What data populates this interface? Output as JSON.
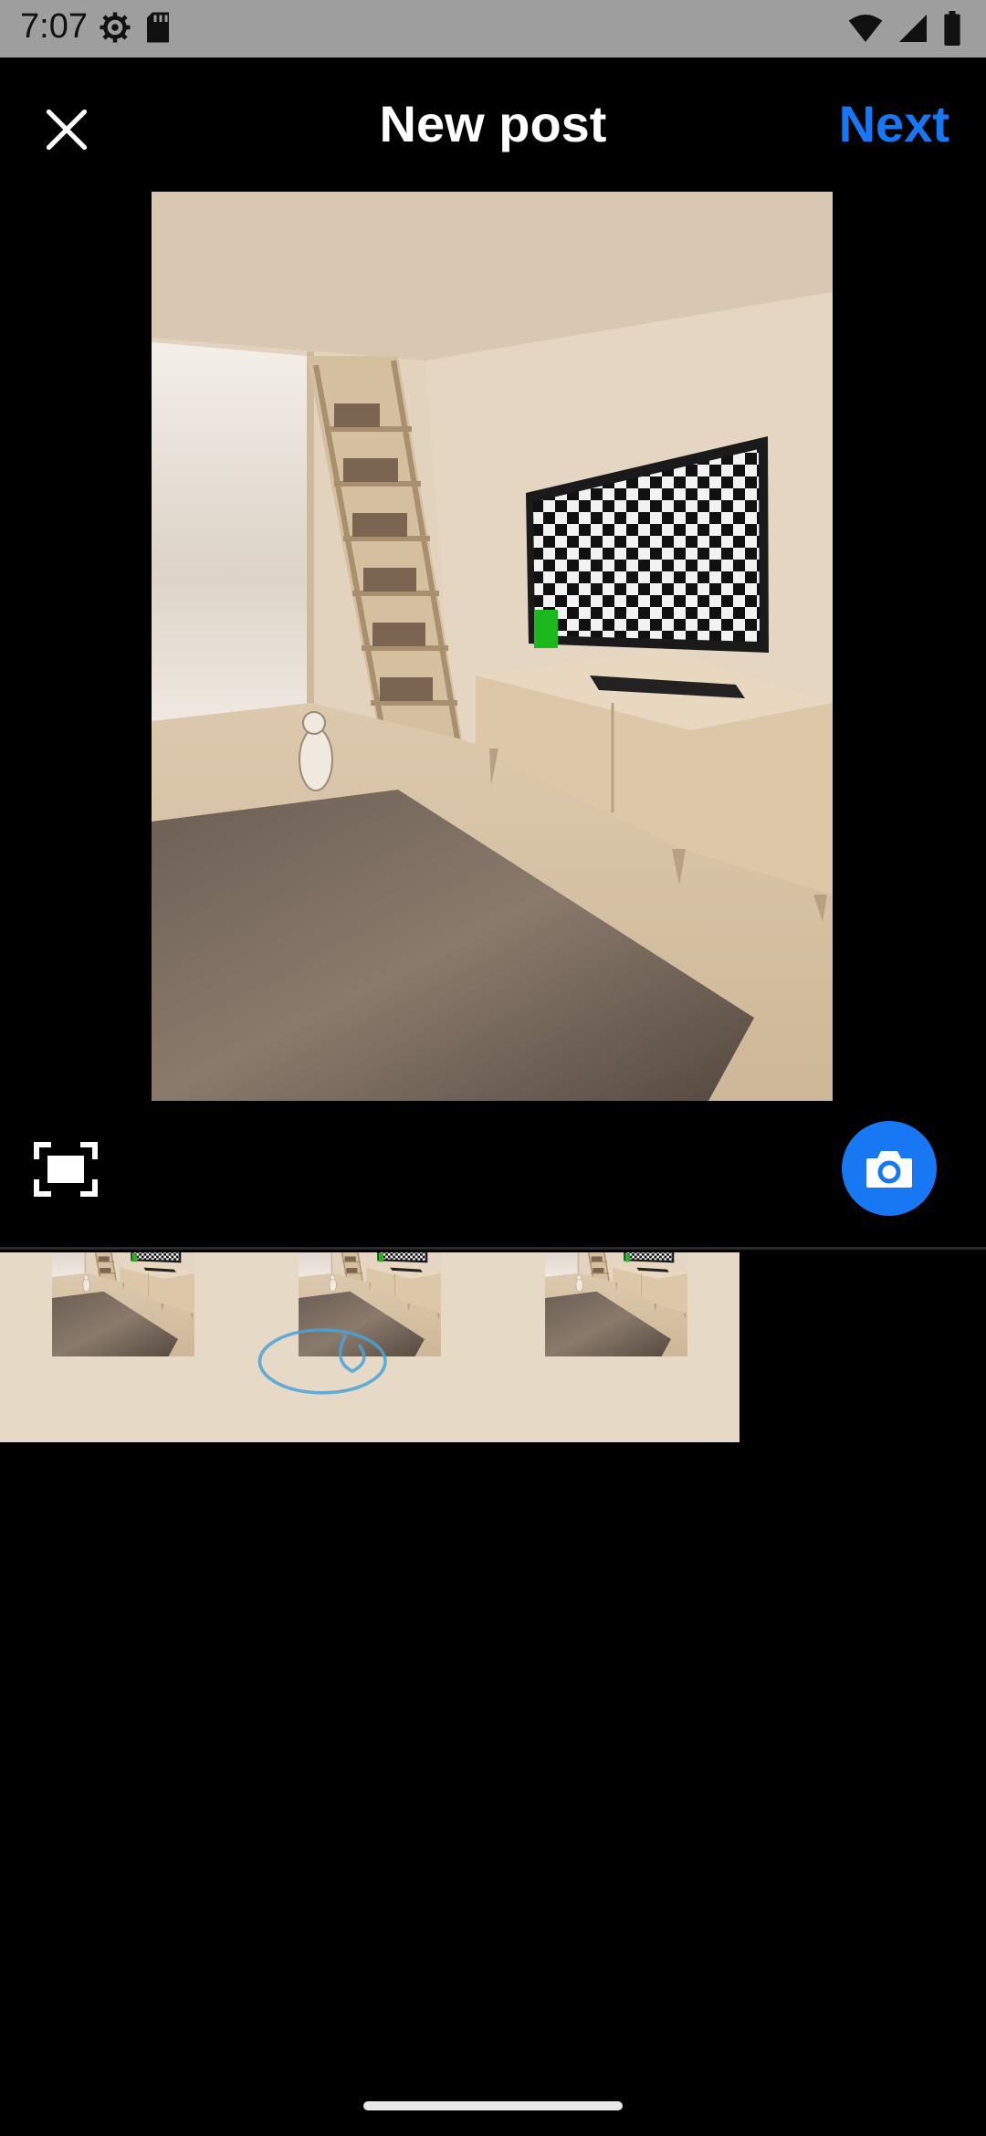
{
  "status_bar": {
    "time": "7:07",
    "icons": [
      "settings-icon",
      "sd-card-icon",
      "wifi-icon",
      "signal-icon",
      "battery-icon"
    ]
  },
  "header": {
    "close_icon": "close-icon",
    "title": "New post",
    "next_label": "Next"
  },
  "preview": {
    "image": "living-room-with-tv-checkerboard"
  },
  "toolbar": {
    "expand_icon": "expand-crop-icon",
    "camera_icon": "camera-icon"
  },
  "gallery": {
    "items": [
      {
        "image": "living-room-thumbnail-1"
      },
      {
        "image": "living-room-thumbnail-2-with-drawing"
      },
      {
        "image": "living-room-thumbnail-3"
      }
    ]
  },
  "colors": {
    "accent": "#1877f2",
    "background": "#000000",
    "status_bar": "#9e9e9e"
  }
}
